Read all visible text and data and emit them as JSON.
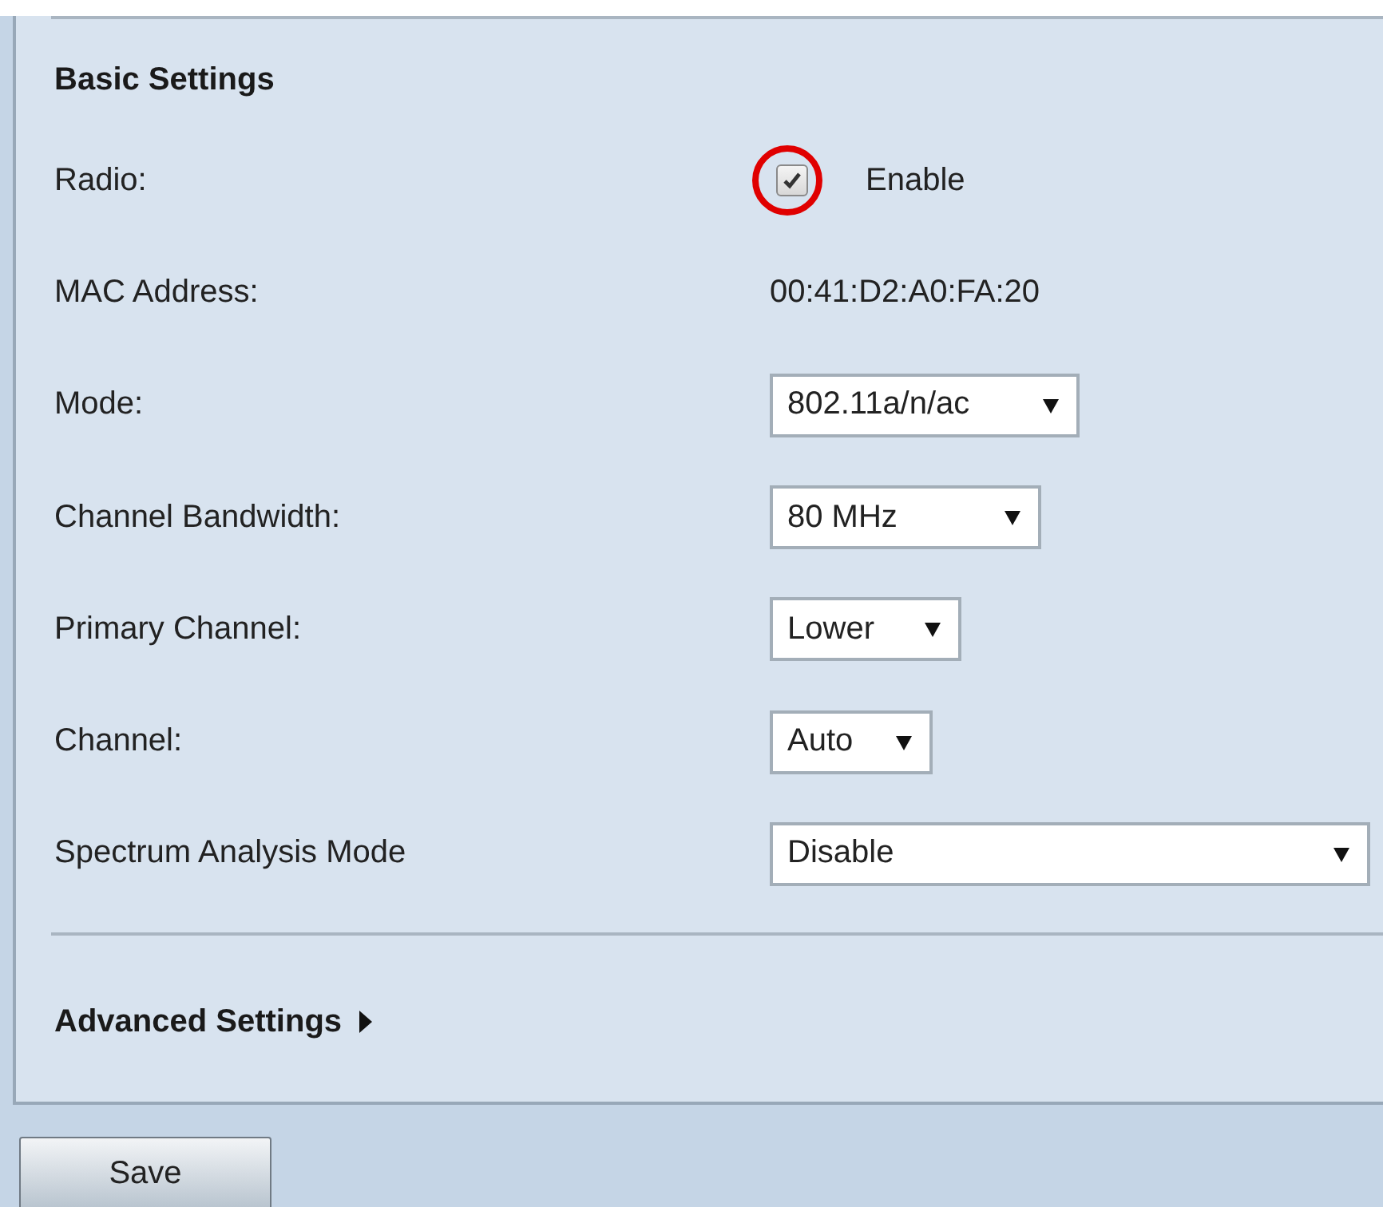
{
  "section_title": "Basic Settings",
  "radio": {
    "label": "Radio:",
    "checked": true,
    "highlighted": true,
    "option": "Enable"
  },
  "mac": {
    "label": "MAC Address:",
    "value": "00:41:D2:A0:FA:20"
  },
  "selects": [
    {
      "label": "Mode:",
      "value": "802.11a/n/ac"
    },
    {
      "label": "Channel Bandwidth:",
      "value": "80 MHz"
    },
    {
      "label": "Primary Channel:",
      "value": "Lower"
    },
    {
      "label": "Channel:",
      "value": "Auto"
    },
    {
      "label": "Spectrum Analysis Mode",
      "value": "Disable"
    }
  ],
  "advanced": {
    "label": "Advanced Settings",
    "expanded": false
  },
  "buttons": [
    "Save"
  ]
}
